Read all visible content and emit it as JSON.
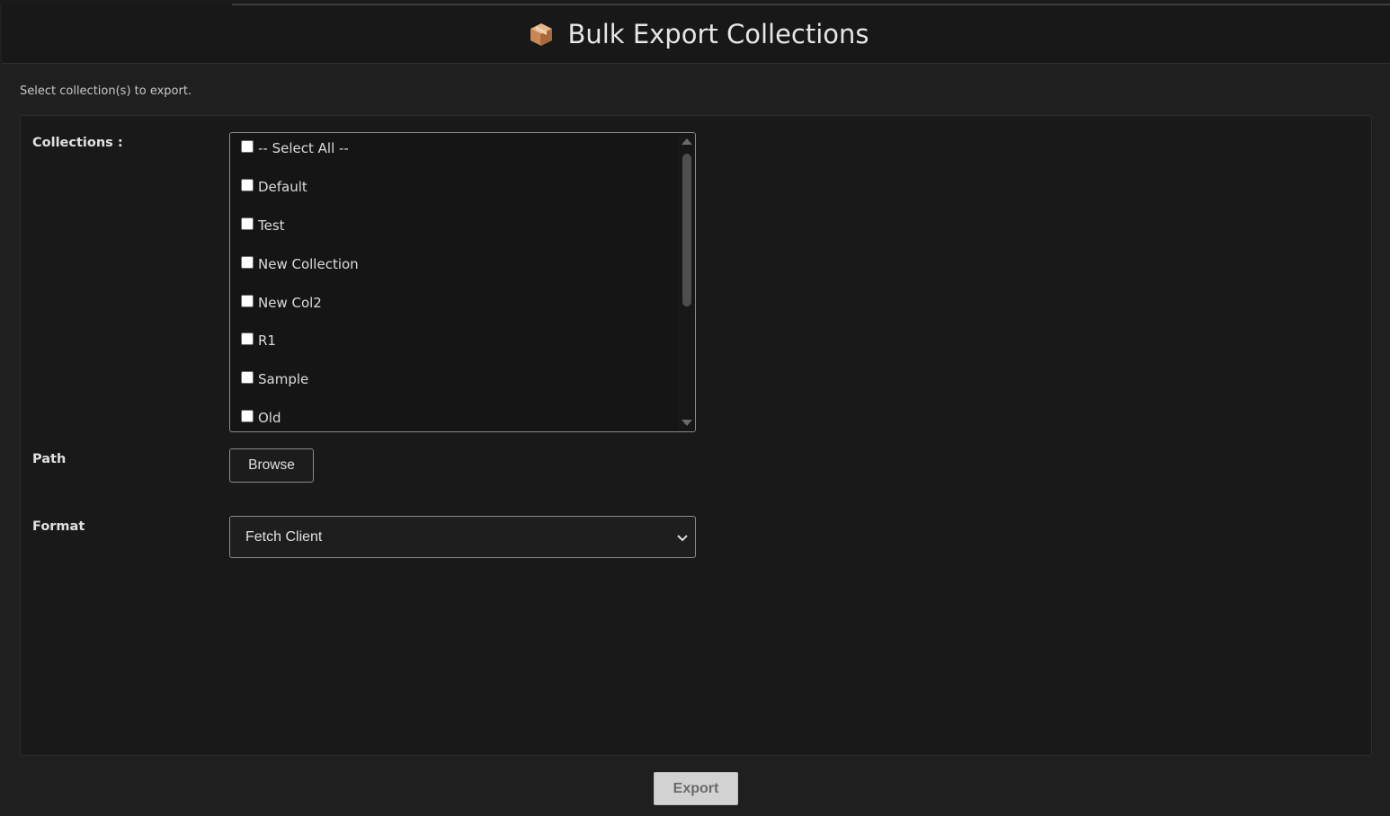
{
  "header": {
    "title": "Bulk Export Collections",
    "icon": "package-box-icon"
  },
  "subtitle": "Select collection(s) to export.",
  "form": {
    "collections_label": "Collections :",
    "collections": [
      {
        "label": "-- Select All --",
        "checked": false
      },
      {
        "label": "Default",
        "checked": false
      },
      {
        "label": "Test",
        "checked": false
      },
      {
        "label": "New Collection",
        "checked": false
      },
      {
        "label": "New Col2",
        "checked": false
      },
      {
        "label": "R1",
        "checked": false
      },
      {
        "label": "Sample",
        "checked": false
      },
      {
        "label": "Old",
        "checked": false
      }
    ],
    "path_label": "Path",
    "browse_label": "Browse",
    "format_label": "Format",
    "format_value": "Fetch Client"
  },
  "footer": {
    "export_label": "Export"
  },
  "colors": {
    "background": "#1f1f1f",
    "panel": "#191919",
    "export_button": "#d2d2d2"
  }
}
